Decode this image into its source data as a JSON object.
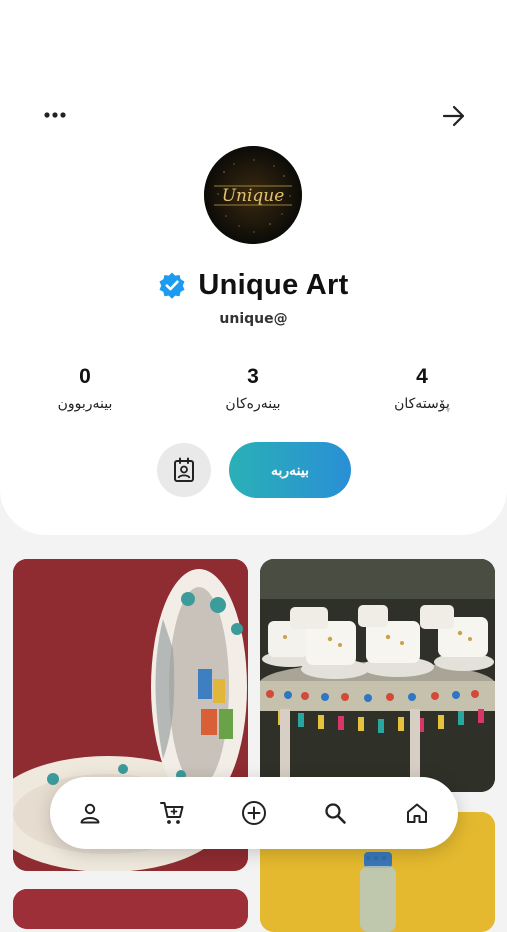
{
  "profile": {
    "name": "Unique Art",
    "handle": "unique@",
    "verified": true,
    "avatar_logo_text": "Unique"
  },
  "stats": {
    "posts": {
      "value": "4",
      "label": "پۆستەکان"
    },
    "viewers": {
      "value": "3",
      "label": "بینەرەکان"
    },
    "viewed": {
      "value": "0",
      "label": "بینەربوون"
    }
  },
  "actions": {
    "follow_label": "بینەربە"
  },
  "icons": {
    "more": "more-horizontal-icon",
    "back": "arrow-right-icon",
    "contact": "contact-card-icon",
    "verified": "verified-badge-icon"
  },
  "gallery": {
    "items": [
      {
        "subject": "painted ceramic vase"
      },
      {
        "subject": "decorated coffee cups set"
      },
      {
        "subject": "red ceramic piece"
      },
      {
        "subject": "beaded glass item"
      }
    ]
  },
  "nav": {
    "items": [
      "profile-icon",
      "cart-icon",
      "add-circle-icon",
      "search-icon",
      "home-icon"
    ]
  },
  "colors": {
    "accent_start": "#2ab0b6",
    "accent_end": "#2a8fd6",
    "verified_blue": "#1d9bf0"
  }
}
